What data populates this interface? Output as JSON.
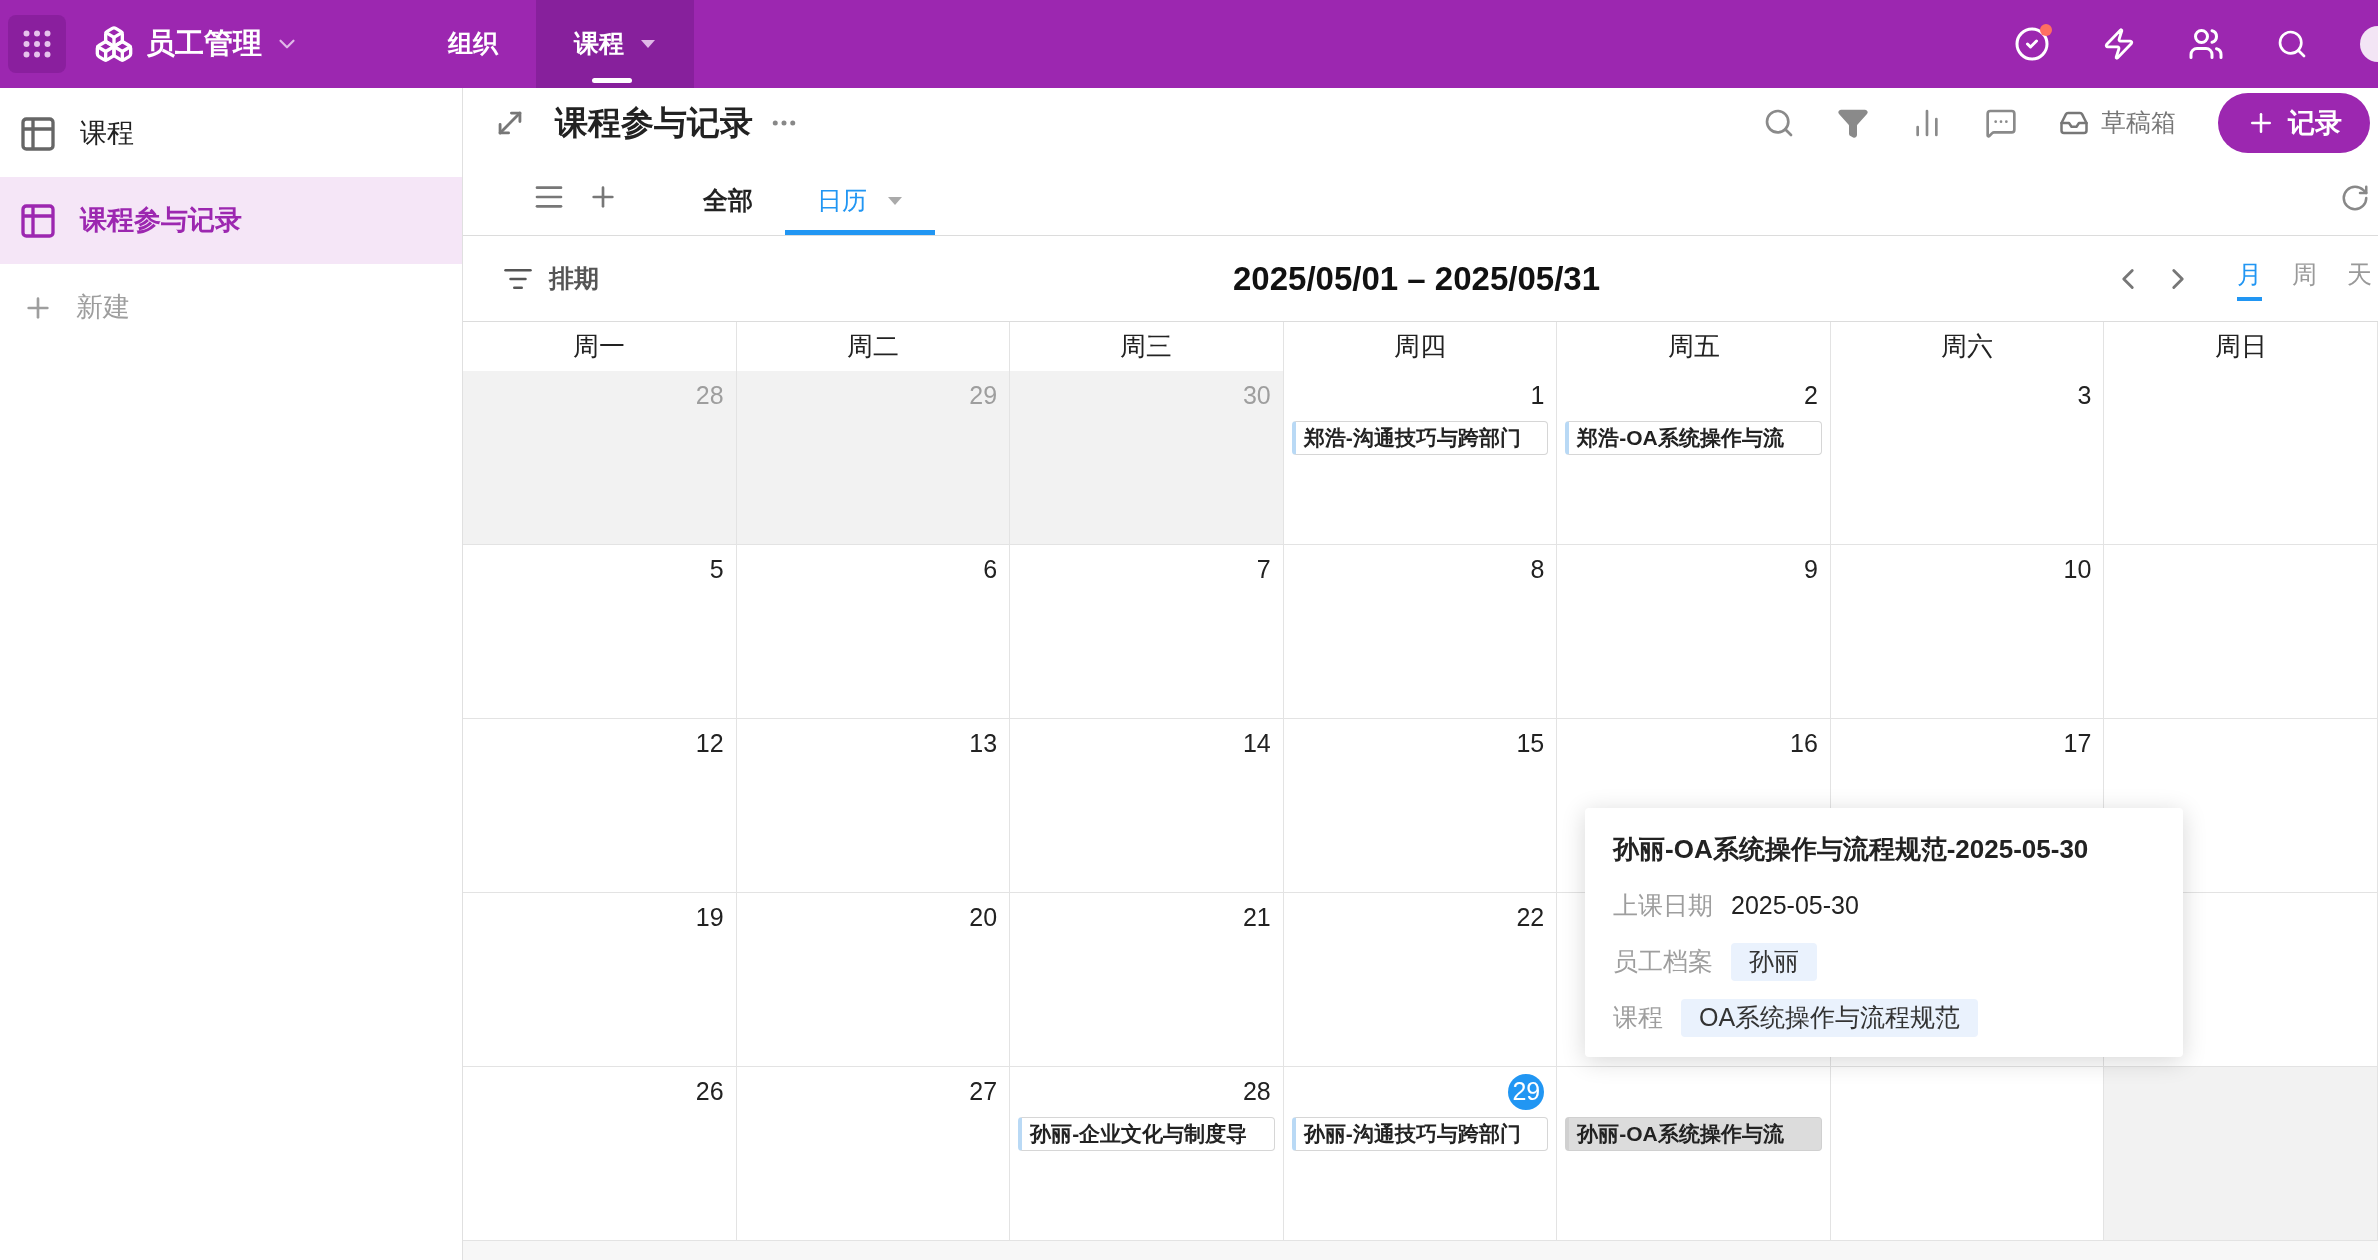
{
  "app_bar": {
    "title": "员工管理",
    "notification": true,
    "tabs": [
      {
        "label": "组织",
        "selected": false
      },
      {
        "label": "课程",
        "selected": true
      }
    ]
  },
  "sidebar": {
    "items": [
      {
        "label": "课程",
        "selected": false
      },
      {
        "label": "课程参与记录",
        "selected": true
      }
    ],
    "new_label": "新建"
  },
  "header": {
    "title": "课程参与记录",
    "drafts": "草稿箱",
    "add_button": "记录"
  },
  "views": [
    {
      "label": "全部",
      "selected": false
    },
    {
      "label": "日历",
      "selected": true
    }
  ],
  "calendar_toolbar": {
    "sort_label": "排期",
    "range": "2025/05/01 – 2025/05/31",
    "modes": [
      {
        "label": "月",
        "selected": true
      },
      {
        "label": "周",
        "selected": false
      },
      {
        "label": "天",
        "selected": false
      }
    ]
  },
  "calendar": {
    "weekdays": [
      "周一",
      "周二",
      "周三",
      "周四",
      "周五",
      "周六",
      "周日"
    ],
    "weeks": [
      [
        {
          "kind": "day",
          "day": "28",
          "outside": true
        },
        {
          "kind": "day",
          "day": "29",
          "outside": true
        },
        {
          "kind": "day",
          "day": "30",
          "outside": true
        },
        {
          "kind": "day",
          "day": "1",
          "outside": false,
          "events": [
            {
              "title": "郑浩-沟通技巧与跨部门",
              "selected": false
            }
          ]
        },
        {
          "kind": "day",
          "day": "2",
          "outside": false,
          "events": [
            {
              "title": "郑浩-OA系统操作与流",
              "selected": false
            }
          ]
        },
        {
          "kind": "day",
          "day": "3",
          "outside": false
        },
        {
          "kind": "blank"
        }
      ],
      [
        {
          "kind": "day",
          "day": "5",
          "outside": false
        },
        {
          "kind": "day",
          "day": "6",
          "outside": false
        },
        {
          "kind": "day",
          "day": "7",
          "outside": false
        },
        {
          "kind": "day",
          "day": "8",
          "outside": false
        },
        {
          "kind": "day",
          "day": "9",
          "outside": false
        },
        {
          "kind": "day",
          "day": "10",
          "outside": false
        },
        {
          "kind": "blank"
        }
      ],
      [
        {
          "kind": "day",
          "day": "12",
          "outside": false
        },
        {
          "kind": "day",
          "day": "13",
          "outside": false
        },
        {
          "kind": "day",
          "day": "14",
          "outside": false
        },
        {
          "kind": "day",
          "day": "15",
          "outside": false
        },
        {
          "kind": "day",
          "day": "16",
          "outside": false
        },
        {
          "kind": "day",
          "day": "17",
          "outside": false
        },
        {
          "kind": "blank"
        }
      ],
      [
        {
          "kind": "day",
          "day": "19",
          "outside": false
        },
        {
          "kind": "day",
          "day": "20",
          "outside": false
        },
        {
          "kind": "day",
          "day": "21",
          "outside": false
        },
        {
          "kind": "day",
          "day": "22",
          "outside": false
        },
        {
          "kind": "blank"
        },
        {
          "kind": "blank"
        },
        {
          "kind": "blank"
        }
      ],
      [
        {
          "kind": "day",
          "day": "26",
          "outside": false
        },
        {
          "kind": "day",
          "day": "27",
          "outside": false
        },
        {
          "kind": "day",
          "day": "28",
          "outside": false,
          "events": [
            {
              "title": "孙丽-企业文化与制度导",
              "selected": false
            }
          ]
        },
        {
          "kind": "day",
          "day": "29",
          "outside": false,
          "today": true,
          "events": [
            {
              "title": "孙丽-沟通技巧与跨部门",
              "selected": false
            }
          ]
        },
        {
          "kind": "blank",
          "events": [
            {
              "title": "孙丽-OA系统操作与流",
              "selected": true
            }
          ]
        },
        {
          "kind": "blank"
        },
        {
          "kind": "blank",
          "outside": true
        }
      ]
    ]
  },
  "popup": {
    "title": "孙丽-OA系统操作与流程规范-2025-05-30",
    "fields": [
      {
        "label": "上课日期",
        "value": "2025-05-30",
        "kind": "text"
      },
      {
        "label": "员工档案",
        "value": "孙丽",
        "kind": "tag"
      },
      {
        "label": "课程",
        "value": "OA系统操作与流程规范",
        "kind": "tag"
      }
    ]
  }
}
